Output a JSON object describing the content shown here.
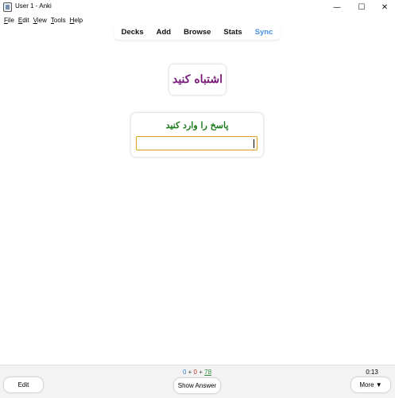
{
  "window": {
    "title": "User 1 - Anki",
    "minimize_glyph": "—",
    "maximize_glyph": "☐",
    "close_glyph": "✕"
  },
  "menubar": {
    "items": [
      {
        "accel": "F",
        "rest": "ile"
      },
      {
        "accel": "E",
        "rest": "dit"
      },
      {
        "accel": "V",
        "rest": "iew"
      },
      {
        "accel": "T",
        "rest": "ools"
      },
      {
        "accel": "H",
        "rest": "elp"
      }
    ]
  },
  "toolbar": {
    "tabs": [
      "Decks",
      "Add",
      "Browse",
      "Stats",
      "Sync"
    ],
    "sync_color": "#4a90e2"
  },
  "card": {
    "front_text": "اشتباه کنید",
    "answer_prompt": "پاسخ را وارد کنید",
    "answer_value": ""
  },
  "bottombar": {
    "edit_label": "Edit",
    "show_answer_label": "Show Answer",
    "more_label": "More ▼",
    "counts": {
      "new": "0",
      "learn": "0",
      "review": "78",
      "plus": "+"
    },
    "timer": "0:13"
  },
  "colors": {
    "front_text": "#7a1a7a",
    "answer_prompt": "#1a7a1a",
    "input_border": "#e0a21a",
    "new_count": "#3a7bd5",
    "learn_count": "#c0392b",
    "review_count": "#2e8b3a"
  }
}
